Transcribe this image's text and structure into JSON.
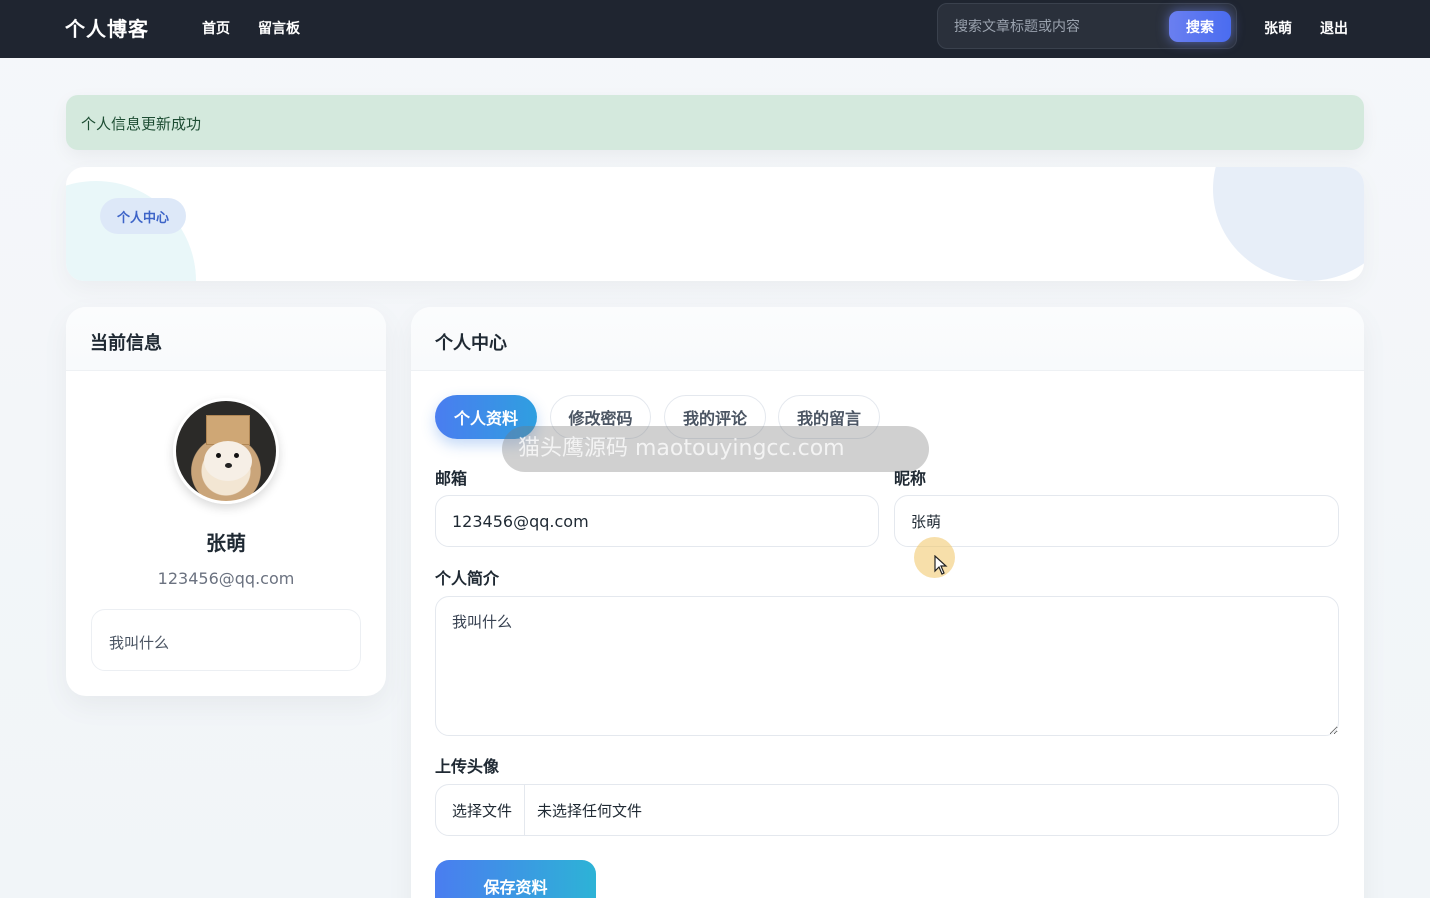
{
  "navbar": {
    "brand": "个人博客",
    "links": [
      "首页",
      "留言板"
    ],
    "search": {
      "placeholder": "搜索文章标题或内容",
      "button": "搜索"
    },
    "user": "张萌",
    "logout": "退出"
  },
  "alert": {
    "message": "个人信息更新成功",
    "color": "#d4e9dd"
  },
  "hero": {
    "pill": "个人中心"
  },
  "left_card": {
    "title": "当前信息",
    "name": "张萌",
    "email": "123456@qq.com",
    "bio": "我叫什么"
  },
  "right_card": {
    "title": "个人中心",
    "tabs": [
      "个人资料",
      "修改密码",
      "我的评论",
      "我的留言"
    ],
    "active_tab": "个人资料",
    "watermark": "猫头鹰源码 maotouyingcc.com",
    "form": {
      "email_label": "邮箱",
      "email_value": "123456@qq.com",
      "nickname_label": "昵称",
      "nickname_value": "张萌",
      "bio_label": "个人简介",
      "bio_value": "我叫什么",
      "avatar_label": "上传头像",
      "file_button": "选择文件",
      "file_status": "未选择任何文件",
      "save_button": "保存资料"
    }
  },
  "colors": {
    "navbar": "#1f2530",
    "accent": "#4a7df0",
    "success_bg": "#d4e9dd"
  }
}
